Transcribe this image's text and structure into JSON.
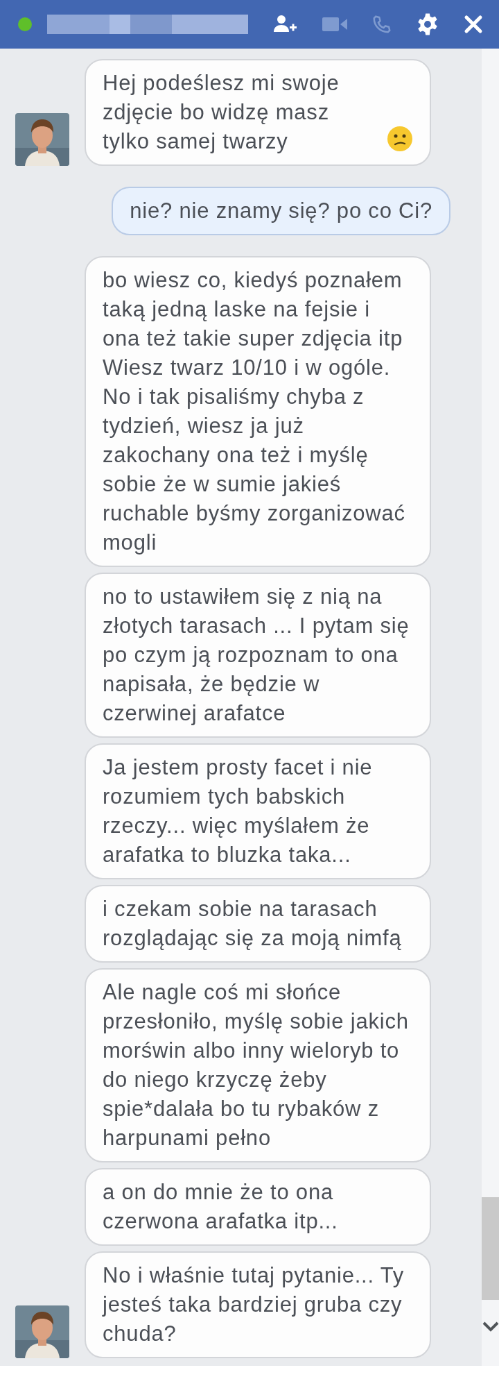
{
  "header": {
    "online": true,
    "buttons": [
      {
        "kind": "add-person",
        "disabled": false
      },
      {
        "kind": "video",
        "disabled": true
      },
      {
        "kind": "phone",
        "disabled": true
      },
      {
        "kind": "settings",
        "disabled": false
      },
      {
        "kind": "close",
        "disabled": false
      }
    ]
  },
  "groups": [
    {
      "kind": "incoming",
      "messages": [
        {
          "text": "Hej podeślesz mi swoje zdjęcie bo widzę masz tylko samej twarzy",
          "emoji": true
        }
      ]
    },
    {
      "kind": "outgoing",
      "messages": [
        {
          "text": "nie? nie znamy się? po co Ci?",
          "emoji": false
        }
      ]
    },
    {
      "kind": "incoming",
      "messages": [
        {
          "text": "bo wiesz co, kiedyś poznałem taką jedną laske na fejsie i ona też takie super zdjęcia itp Wiesz twarz 10/10 i w ogóle. No i tak pisaliśmy chyba z tydzień, wiesz ja już zakochany ona też i myślę sobie że w sumie jakieś ruchable byśmy zorganizować mogli",
          "emoji": false
        },
        {
          "text": "no to ustawiłem się z nią na złotych tarasach ... I pytam się po czym ją rozpoznam to ona napisała, że będzie w czerwinej arafatce",
          "emoji": false
        },
        {
          "text": "Ja jestem prosty facet i nie rozumiem tych babskich rzeczy... więc myślałem że arafatka to bluzka taka...",
          "emoji": false
        },
        {
          "text": "i czekam sobie na tarasach rozglądając się za moją nimfą",
          "emoji": false
        },
        {
          "text": "Ale nagle coś mi słońce przesłoniło, myślę sobie jakich morświn albo inny wieloryb to do niego krzyczę żeby spie*dalała bo tu rybaków z harpunami pełno",
          "emoji": false
        },
        {
          "text": "a on do mnie że to ona czerwona arafatka itp...",
          "emoji": false
        },
        {
          "text": "No i właśnie tutaj pytanie... Ty jesteś taka bardziej gruba czy chuda?",
          "emoji": false
        }
      ]
    }
  ]
}
